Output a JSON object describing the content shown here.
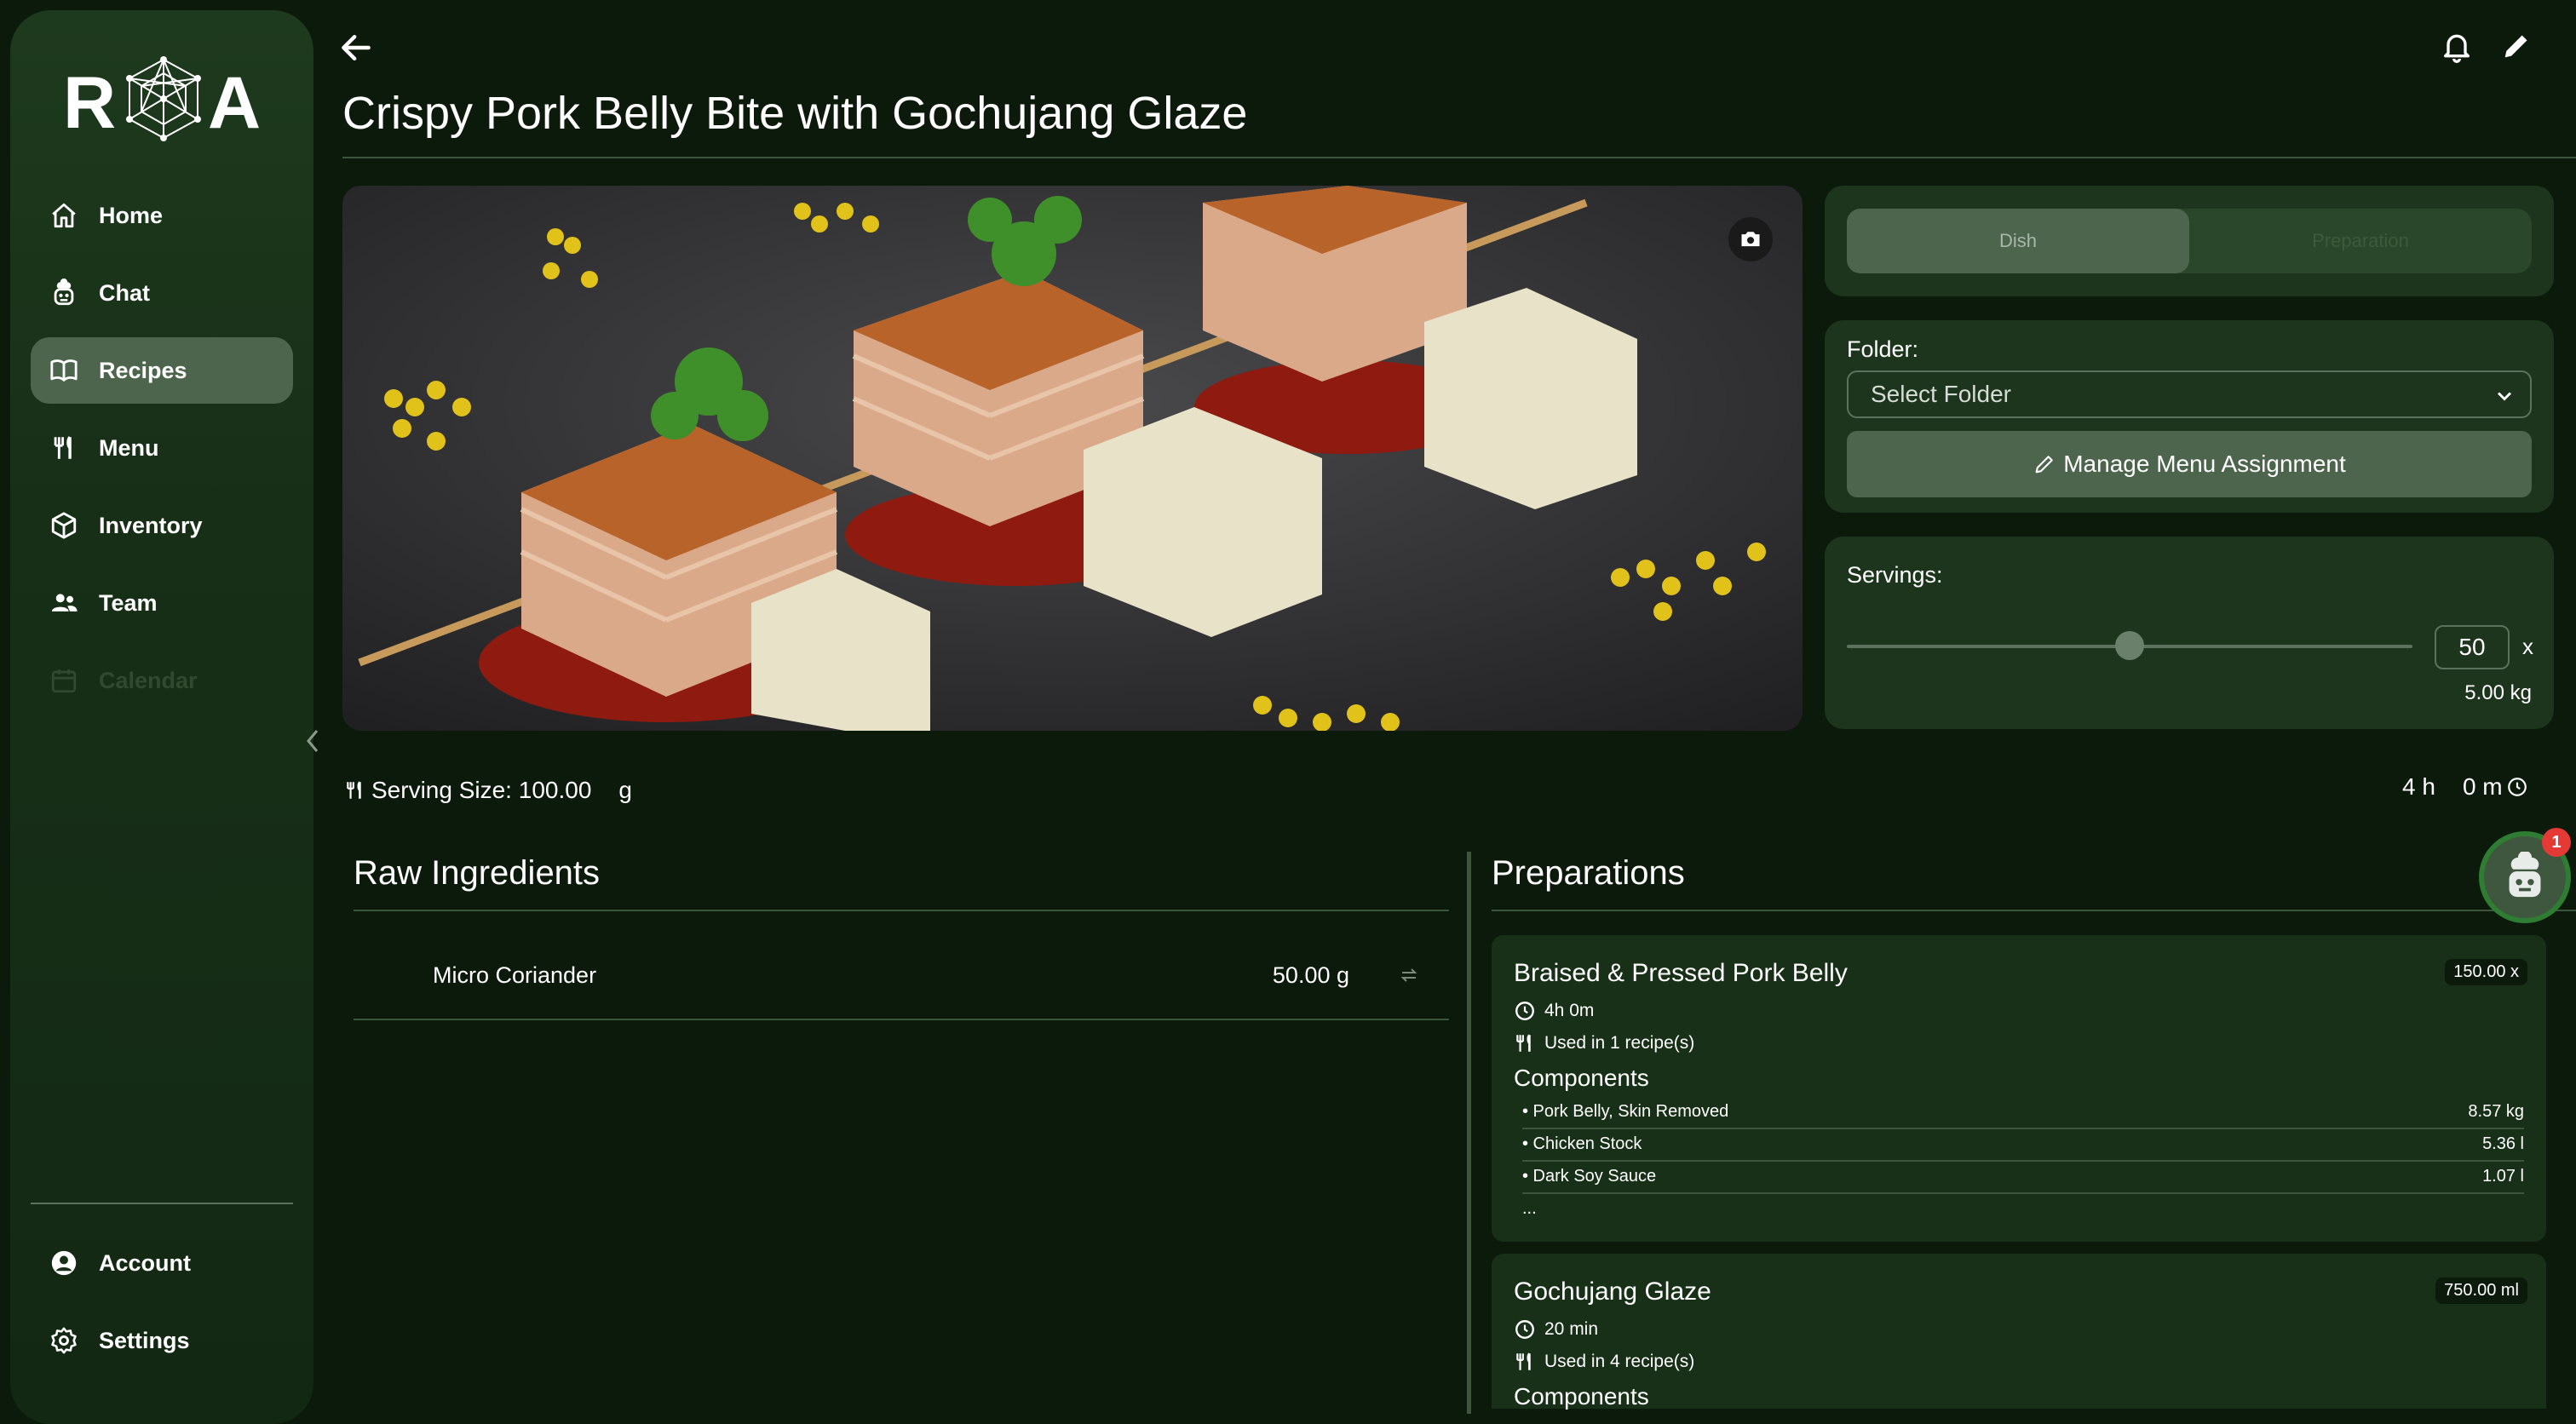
{
  "brand": {
    "logo_left": "R",
    "logo_right": "A"
  },
  "sidebar": {
    "items": [
      {
        "label": "Home",
        "icon": "home-icon",
        "active": false,
        "disabled": false
      },
      {
        "label": "Chat",
        "icon": "chef-bot-icon",
        "active": false,
        "disabled": false
      },
      {
        "label": "Recipes",
        "icon": "book-icon",
        "active": true,
        "disabled": false
      },
      {
        "label": "Menu",
        "icon": "utensils-icon",
        "active": false,
        "disabled": false
      },
      {
        "label": "Inventory",
        "icon": "box-icon",
        "active": false,
        "disabled": false
      },
      {
        "label": "Team",
        "icon": "team-icon",
        "active": false,
        "disabled": false
      },
      {
        "label": "Calendar",
        "icon": "calendar-icon",
        "active": false,
        "disabled": true
      }
    ],
    "bottom": [
      {
        "label": "Account",
        "icon": "account-icon"
      },
      {
        "label": "Settings",
        "icon": "gear-icon"
      }
    ]
  },
  "recipe": {
    "title": "Crispy Pork Belly Bite with Gochujang Glaze",
    "serving_size_label": "Serving Size: 100.00",
    "serving_size_unit": "g",
    "time_hours": "4 h",
    "time_minutes": "0 m"
  },
  "tabs": {
    "dish": "Dish",
    "preparation": "Preparation"
  },
  "folder": {
    "label": "Folder:",
    "placeholder": "Select Folder",
    "manage_label": "Manage Menu Assignment"
  },
  "servings": {
    "label": "Servings:",
    "value": "50",
    "multiplier": "x",
    "weight": "5.00 kg",
    "slider_fraction": 0.5
  },
  "raw_ingredients": {
    "title": "Raw Ingredients",
    "items": [
      {
        "name": "Micro Coriander",
        "qty": "50.00 g"
      }
    ]
  },
  "preparations": {
    "title": "Preparations",
    "items": [
      {
        "name": "Braised & Pressed Pork Belly",
        "badge": "150.00 x",
        "time": "4h 0m",
        "used": "Used in 1 recipe(s)",
        "components_label": "Components",
        "components": [
          {
            "name": "• Pork Belly, Skin Removed",
            "qty": "8.57 kg"
          },
          {
            "name": "• Chicken Stock",
            "qty": "5.36 l"
          },
          {
            "name": "• Dark Soy Sauce",
            "qty": "1.07 l"
          }
        ],
        "more": "..."
      },
      {
        "name": "Gochujang Glaze",
        "badge": "750.00 ml",
        "time": "20 min",
        "used": "Used in 4 recipe(s)",
        "components_label": "Components"
      }
    ]
  },
  "assistant": {
    "badge_count": "1"
  },
  "colors": {
    "background": "#0c1a0c",
    "sidebar": "#1e3a1e",
    "active": "#4d654d",
    "badge": "#e53935"
  }
}
